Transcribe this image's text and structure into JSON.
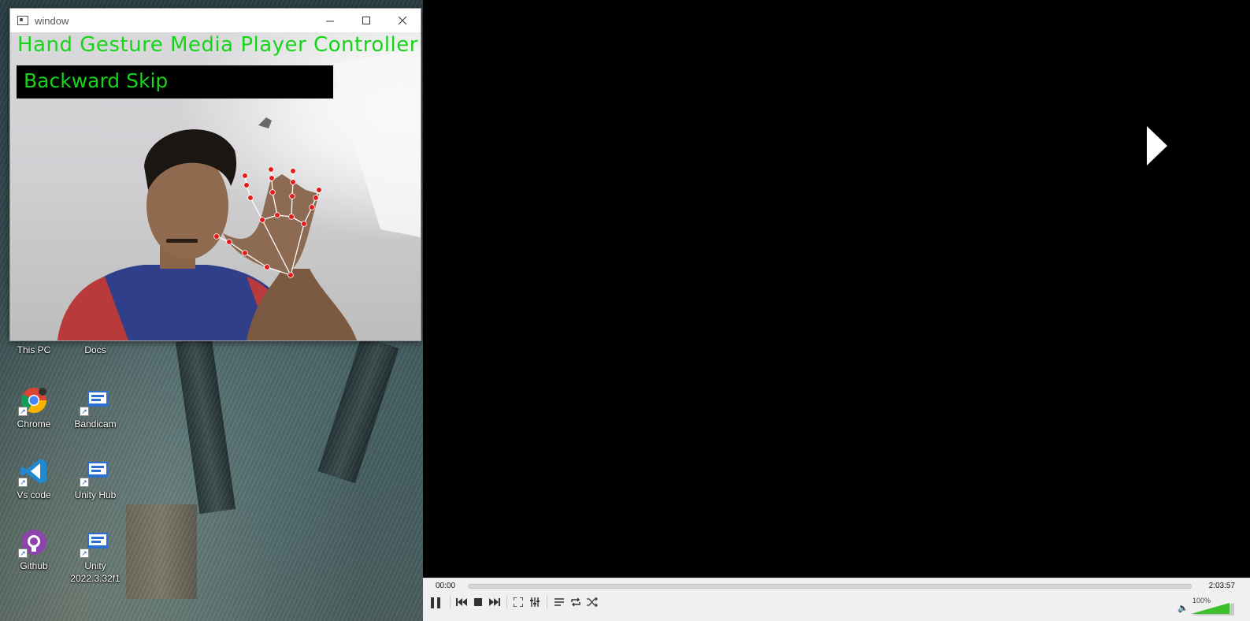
{
  "camera_window": {
    "title": "window",
    "overlay_title": "Hand Gesture Media Player Controller",
    "gesture_label": "Backward Skip"
  },
  "desktop": {
    "icons": [
      {
        "label": "This PC",
        "icon": "this-pc-icon"
      },
      {
        "label": "Docs",
        "icon": "folder-icon"
      },
      {
        "label": "Chrome",
        "icon": "chrome-icon"
      },
      {
        "label": "Bandicam",
        "icon": "bandicam-icon"
      },
      {
        "label": "Vs code",
        "icon": "vscode-icon"
      },
      {
        "label": "Unity Hub",
        "icon": "unity-hub-icon"
      },
      {
        "label": "Github",
        "icon": "github-icon"
      },
      {
        "label": "Unity\n2022.3.32f1",
        "icon": "unity-icon"
      }
    ]
  },
  "player": {
    "time_elapsed": "00:00",
    "time_total": "2:03:57",
    "progress": 0.0,
    "volume": "100%",
    "volume_level": 1.0,
    "state": "paused",
    "colors": {
      "seek": "#5a8fd6",
      "volume": "#3bbf2b",
      "overlay_text": "#18d418"
    }
  }
}
